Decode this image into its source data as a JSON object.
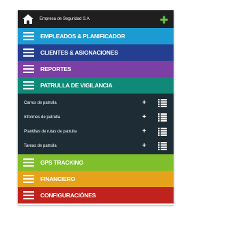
{
  "header": {
    "company": "Empresa de Seguridad S.A."
  },
  "menu": {
    "empleados": "EMPLEADOS & PLANIFICADOR",
    "clientes": "CLIENTES & ASIGNACIONES",
    "reportes": "REPORTES",
    "patrulla": "PATRULLA DE VIGILANCIA",
    "gps": "GPS TRACKING",
    "financiero": "FINANCIERO",
    "config": "CONFIGURACIÓNES"
  },
  "patrulla_items": [
    {
      "label": "Carros de patrulla",
      "plus": "+"
    },
    {
      "label": "Informes de patrulla",
      "plus": "+"
    },
    {
      "label": "Plantillas de rutas de patrulla",
      "plus": "+"
    },
    {
      "label": "Tareas de patrulla",
      "plus": "+"
    }
  ],
  "colors": {
    "empleados": "#1c9bd3",
    "clientes": "#243f8f",
    "reportes": "#7c3fa3",
    "patrulla": "#0f8a78",
    "gps": "#7fbf2c",
    "financiero": "#e6a21b",
    "config": "#c0231e"
  }
}
